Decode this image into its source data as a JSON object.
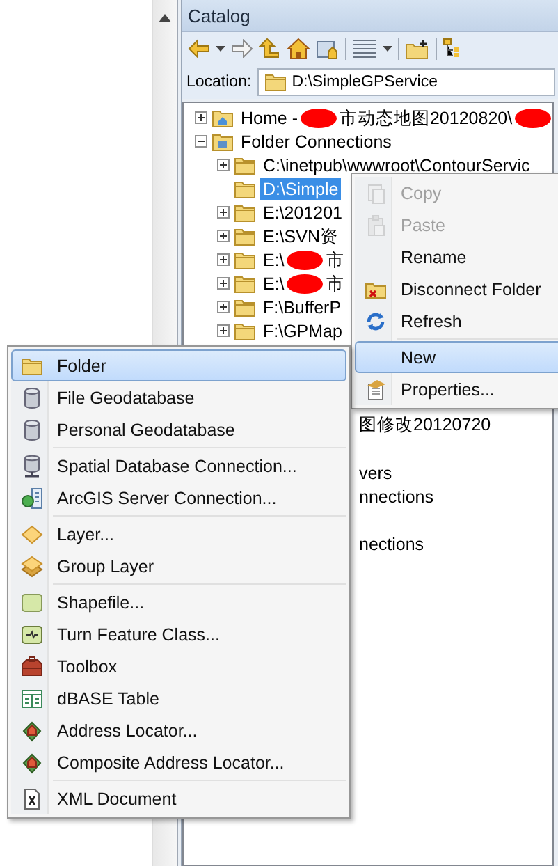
{
  "catalog": {
    "title": "Catalog",
    "location": {
      "label": "Location:",
      "value": "D:\\SimpleGPService"
    },
    "tree": [
      {
        "expanded": false,
        "selected": false,
        "segments": [
          {
            "text": "Home - "
          },
          {
            "kind": "redaction"
          },
          {
            "text": "市动态地图20120820\\"
          },
          {
            "kind": "redaction"
          }
        ]
      },
      {
        "expanded": true,
        "selected": false,
        "segments": [
          {
            "text": "Folder Connections"
          }
        ],
        "children": [
          {
            "expanded": false,
            "selected": false,
            "segments": [
              {
                "text": "C:\\inetpub\\wwwroot\\ContourServic"
              }
            ]
          },
          {
            "selected": true,
            "segments": [
              {
                "text": "D:\\Simple"
              }
            ]
          },
          {
            "expanded": false,
            "selected": false,
            "segments": [
              {
                "text": "E:\\201201"
              }
            ]
          },
          {
            "expanded": false,
            "selected": false,
            "segments": [
              {
                "text": "E:\\SVN资"
              }
            ]
          },
          {
            "expanded": false,
            "selected": false,
            "segments": [
              {
                "text": "E:\\"
              },
              {
                "kind": "redaction"
              },
              {
                "text": "市"
              }
            ]
          },
          {
            "expanded": false,
            "selected": false,
            "segments": [
              {
                "text": "E:\\"
              },
              {
                "kind": "redaction"
              },
              {
                "text": "市"
              }
            ]
          },
          {
            "expanded": false,
            "selected": false,
            "segments": [
              {
                "text": "F:\\BufferP"
              }
            ]
          },
          {
            "expanded": false,
            "selected": false,
            "segments": [
              {
                "text": "F:\\GPMap"
              }
            ]
          }
        ]
      }
    ],
    "clipped_rows": [
      {
        "text": "图修改20120720"
      },
      {
        "text": "vers"
      },
      {
        "text": "nnections"
      },
      {
        "text": "nections"
      }
    ]
  },
  "context_menu": {
    "groups": [
      [
        {
          "label": "Copy",
          "disabled": true,
          "selected": false
        },
        {
          "label": "Paste",
          "disabled": true,
          "selected": false
        },
        {
          "label": "Rename",
          "disabled": false,
          "selected": false
        },
        {
          "label": "Disconnect Folder",
          "disabled": false,
          "selected": false
        },
        {
          "label": "Refresh",
          "disabled": false,
          "selected": false
        }
      ],
      [
        {
          "label": "New",
          "disabled": false,
          "selected": true
        },
        {
          "label": "Properties...",
          "disabled": false,
          "selected": false
        }
      ]
    ]
  },
  "new_submenu": {
    "groups": [
      [
        {
          "label": "Folder",
          "selected": true
        },
        {
          "label": "File Geodatabase",
          "selected": false
        },
        {
          "label": "Personal Geodatabase",
          "selected": false
        }
      ],
      [
        {
          "label": "Spatial Database Connection...",
          "selected": false
        },
        {
          "label": "ArcGIS Server Connection...",
          "selected": false
        }
      ],
      [
        {
          "label": "Layer...",
          "selected": false
        },
        {
          "label": "Group Layer",
          "selected": false
        }
      ],
      [
        {
          "label": "Shapefile...",
          "selected": false
        },
        {
          "label": "Turn Feature Class...",
          "selected": false
        },
        {
          "label": "Toolbox",
          "selected": false
        },
        {
          "label": "dBASE Table",
          "selected": false
        },
        {
          "label": "Address Locator...",
          "selected": false
        },
        {
          "label": "Composite Address Locator...",
          "selected": false
        }
      ],
      [
        {
          "label": "XML Document",
          "selected": false
        }
      ]
    ]
  }
}
